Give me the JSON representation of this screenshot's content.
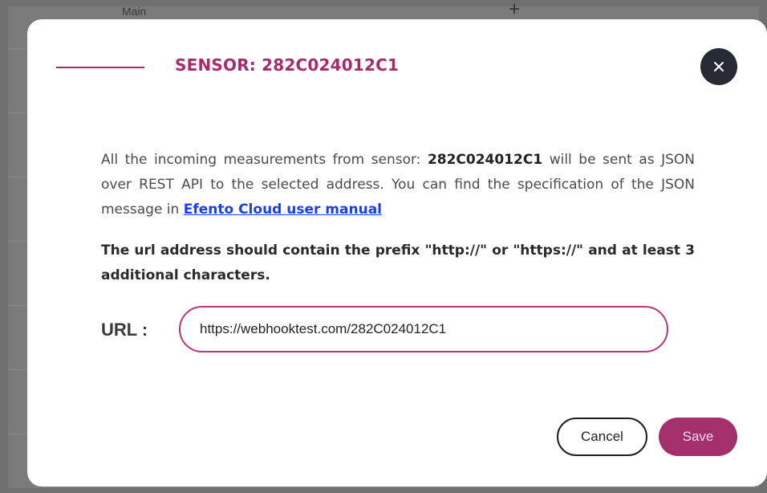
{
  "background": {
    "tab_label": "Main",
    "add_icon": "plus-icon"
  },
  "modal": {
    "title": "SENSOR: 282C024012C1",
    "close_icon": "close-icon",
    "description": {
      "part1": "All the incoming measurements from sensor: ",
      "sensor_id": "282C024012C1",
      "part2": " will be sent as JSON over REST API to the selected address. You can find the specification of the JSON message in ",
      "link_text": "Efento Cloud user manual"
    },
    "note": "The url address should contain the prefix \"http://\" or \"https://\" and at least 3 additional characters.",
    "url": {
      "label": "URL :",
      "value": "https://webhooktest.com/282C024012C1"
    },
    "cancel_label": "Cancel",
    "save_label": "Save"
  },
  "colors": {
    "accent": "#a82a6c",
    "close_bg": "#262b33",
    "link": "#1a3ee8"
  }
}
